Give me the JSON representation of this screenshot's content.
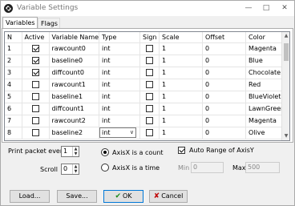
{
  "window": {
    "title": "Variable Settings"
  },
  "tabs": [
    {
      "label": "Variables"
    },
    {
      "label": "Flags"
    }
  ],
  "grid": {
    "columns": [
      "N",
      "Active",
      "Variable Name",
      "Type",
      "Sign",
      "Scale",
      "Offset",
      "Color"
    ],
    "rows": [
      {
        "n": "1",
        "active": true,
        "name": "rawcount0",
        "type": "int",
        "sign": false,
        "scale": "1",
        "offset": "0",
        "color": "Magenta"
      },
      {
        "n": "2",
        "active": true,
        "name": "baseline0",
        "type": "int",
        "sign": false,
        "scale": "1",
        "offset": "0",
        "color": "Blue"
      },
      {
        "n": "3",
        "active": true,
        "name": "diffcount0",
        "type": "int",
        "sign": false,
        "scale": "1",
        "offset": "0",
        "color": "Chocolate"
      },
      {
        "n": "4",
        "active": false,
        "name": "rawcount1",
        "type": "int",
        "sign": false,
        "scale": "1",
        "offset": "0",
        "color": "Red"
      },
      {
        "n": "5",
        "active": false,
        "name": "baseline1",
        "type": "int",
        "sign": false,
        "scale": "1",
        "offset": "0",
        "color": "BlueViolet"
      },
      {
        "n": "6",
        "active": false,
        "name": "diffcount1",
        "type": "int",
        "sign": false,
        "scale": "1",
        "offset": "0",
        "color": "LawnGreen"
      },
      {
        "n": "7",
        "active": false,
        "name": "rawcount2",
        "type": "int",
        "sign": false,
        "scale": "1",
        "offset": "0",
        "color": "Magenta"
      },
      {
        "n": "8",
        "active": false,
        "name": "baseline2",
        "type": "int",
        "sign": false,
        "scale": "1",
        "offset": "0",
        "color": "Olive",
        "editing": true
      }
    ]
  },
  "controls": {
    "print_packet_label": "Print packet every",
    "print_packet_value": "1",
    "scroll_label": "Scroll",
    "scroll_value": "0",
    "radio_count_label": "AxisX is a count",
    "radio_time_label": "AxisX is a time",
    "radio_selected": "count",
    "auto_range_label": "Auto Range of AxisY",
    "auto_range_checked": true,
    "min_label": "Min",
    "min_value": "0",
    "max_label": "Max",
    "max_value": "500"
  },
  "buttons": {
    "load": "Load...",
    "save": "Save...",
    "ok": "OK",
    "cancel": "Cancel"
  },
  "colors": {
    "ok_check": "#1a8a1a",
    "cancel_x": "#c00000"
  }
}
